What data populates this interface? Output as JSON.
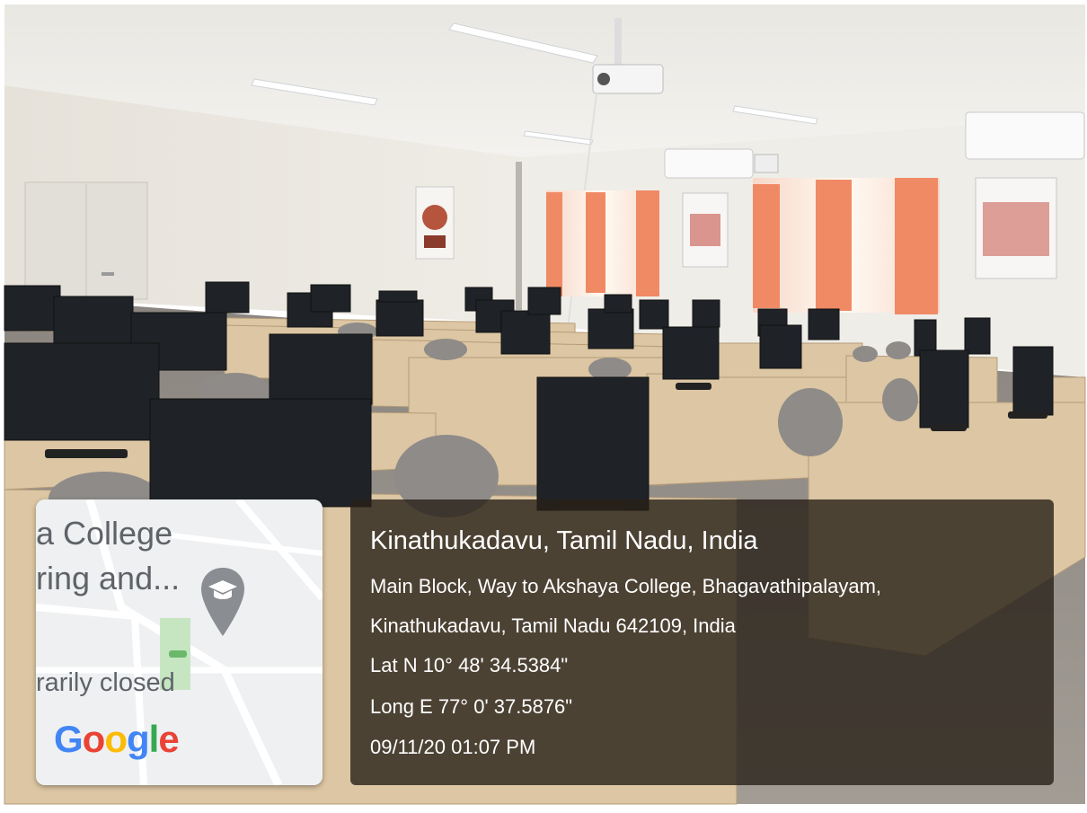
{
  "photo": {
    "subject": "computer-lab-classroom"
  },
  "map_card": {
    "label_line1": "a College",
    "label_line2": "ring and...",
    "label_line3": "rarily closed",
    "marker_icon": "graduation-cap-icon",
    "logo": {
      "letters": [
        "G",
        "o",
        "o",
        "g",
        "l",
        "e"
      ],
      "colors": [
        "#4285f4",
        "#ea4335",
        "#fbbc05",
        "#4285f4",
        "#34a853",
        "#ea4335"
      ]
    }
  },
  "location": {
    "title": "Kinathukadavu, Tamil Nadu, India",
    "address_line1": "Main Block, Way to Akshaya College, Bhagavathipalayam,",
    "address_line2": "Kinathukadavu, Tamil Nadu 642109, India",
    "latitude": "Lat N 10° 48' 34.5384\"",
    "longitude": "Long E 77° 0' 37.5876\"",
    "datetime": "09/11/20 01:07 PM"
  }
}
